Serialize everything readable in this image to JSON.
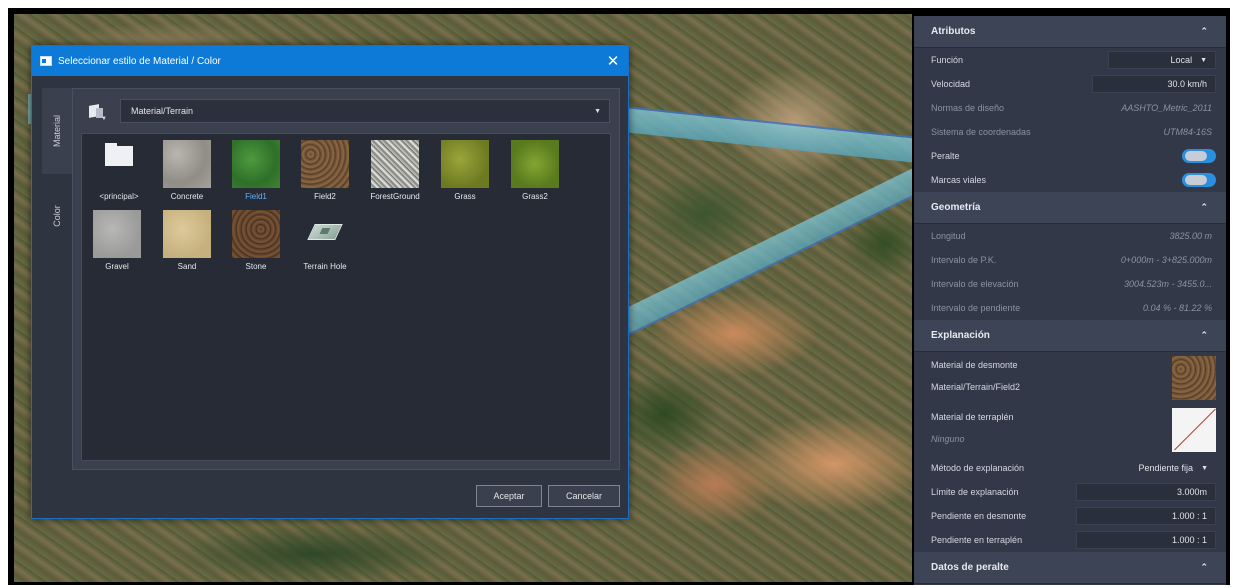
{
  "dialog": {
    "title": "Seleccionar estilo de Material / Color",
    "close_symbol": "✕",
    "tabs": [
      "Material",
      "Color"
    ],
    "path": "Material/Terrain",
    "tiles": [
      {
        "label": "<principal>",
        "swatch": "folder"
      },
      {
        "label": "Concrete",
        "swatch": "concrete"
      },
      {
        "label": "Field1",
        "swatch": "field1",
        "selected": true
      },
      {
        "label": "Field2",
        "swatch": "field2"
      },
      {
        "label": "ForestGround",
        "swatch": "forest"
      },
      {
        "label": "Grass",
        "swatch": "grass"
      },
      {
        "label": "Grass2",
        "swatch": "grass2"
      },
      {
        "label": "Gravel",
        "swatch": "gravel"
      },
      {
        "label": "Sand",
        "swatch": "sand"
      },
      {
        "label": "Stone",
        "swatch": "stone"
      },
      {
        "label": "Terrain Hole",
        "swatch": "hole"
      }
    ],
    "ok_label": "Aceptar",
    "cancel_label": "Cancelar"
  },
  "panel": {
    "atributos": {
      "title": "Atributos",
      "funcion_label": "Función",
      "funcion_value": "Local",
      "velocidad_label": "Velocidad",
      "velocidad_value": "30.0 km/h",
      "normas_label": "Normas de diseño",
      "normas_value": "AASHTO_Metric_2011",
      "sistema_label": "Sistema de coordenadas",
      "sistema_value": "UTM84-16S",
      "peralte_label": "Peralte",
      "marcas_label": "Marcas viales"
    },
    "geometria": {
      "title": "Geometría",
      "longitud_label": "Longitud",
      "longitud_value": "3825.00 m",
      "intervalo_pk_label": "Intervalo de P.K.",
      "intervalo_pk_value": "0+000m - 3+825.000m",
      "intervalo_elev_label": "Intervalo de elevación",
      "intervalo_elev_value": "3004.523m - 3455.0...",
      "intervalo_pend_label": "Intervalo de pendiente",
      "intervalo_pend_value": "0.04 % - 81.22 %"
    },
    "explanacion": {
      "title": "Explanación",
      "desmonte_label": "Material de desmonte",
      "desmonte_value": "Material/Terrain/Field2",
      "terraplen_label": "Material de terraplén",
      "terraplen_value": "Ninguno",
      "metodo_label": "Método de explanación",
      "metodo_value": "Pendiente fija",
      "limite_label": "Límite de explanación",
      "limite_value": "3.000m",
      "pend_desmonte_label": "Pendiente en desmonte",
      "pend_desmonte_value": "1.000 : 1",
      "pend_terraplen_label": "Pendiente en terraplén",
      "pend_terraplen_value": "1.000 : 1"
    },
    "next_section_title": "Datos de peralte",
    "collapse_symbol": "⌃"
  }
}
